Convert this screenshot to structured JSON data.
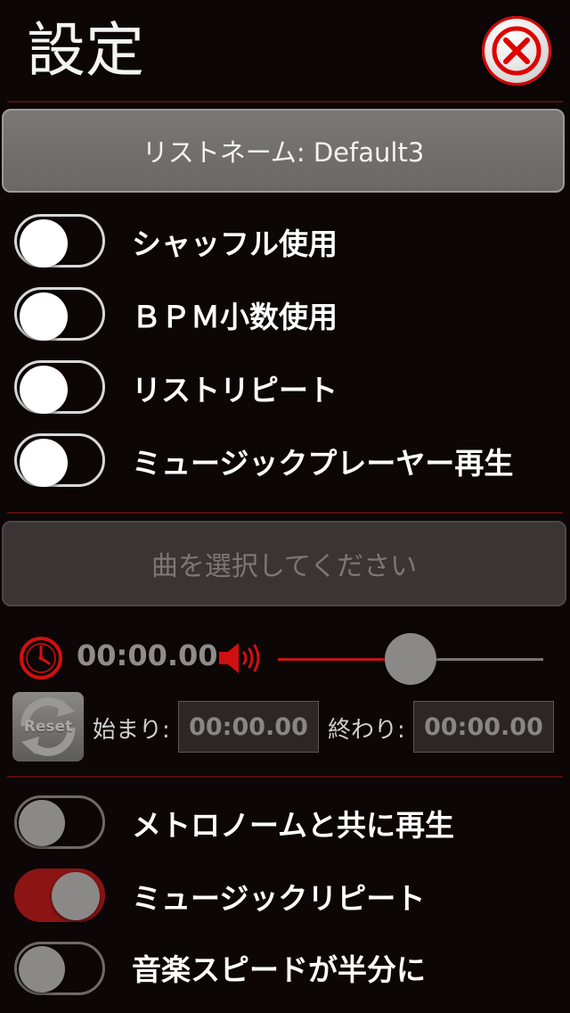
{
  "header": {
    "title": "設定"
  },
  "list_button": {
    "label": "リストネーム: Default3"
  },
  "toggles_top": [
    {
      "label": "シャッフル使用",
      "on": false
    },
    {
      "label": "ＢＰＭ小数使用",
      "on": false
    },
    {
      "label": "リストリピート",
      "on": false
    },
    {
      "label": "ミュージックプレーヤー再生",
      "on": false
    }
  ],
  "select_button": {
    "label": "曲を選択してください"
  },
  "player": {
    "time": "00:00.00",
    "volume_level": 0.5,
    "reset_label": "Reset",
    "start_label": "始まり:",
    "start_value": "00:00.00",
    "end_label": "終わり:",
    "end_value": "00:00.00"
  },
  "toggles_bottom": [
    {
      "label": "メトロノームと共に再生",
      "on": false
    },
    {
      "label": "ミュージックリピート",
      "on": true
    },
    {
      "label": "音楽スピードが半分に",
      "on": false
    }
  ],
  "colors": {
    "accent": "#c01818",
    "background": "#0d0606"
  },
  "icons": [
    "close-icon",
    "clock-icon",
    "speaker-icon",
    "reset-icon"
  ]
}
